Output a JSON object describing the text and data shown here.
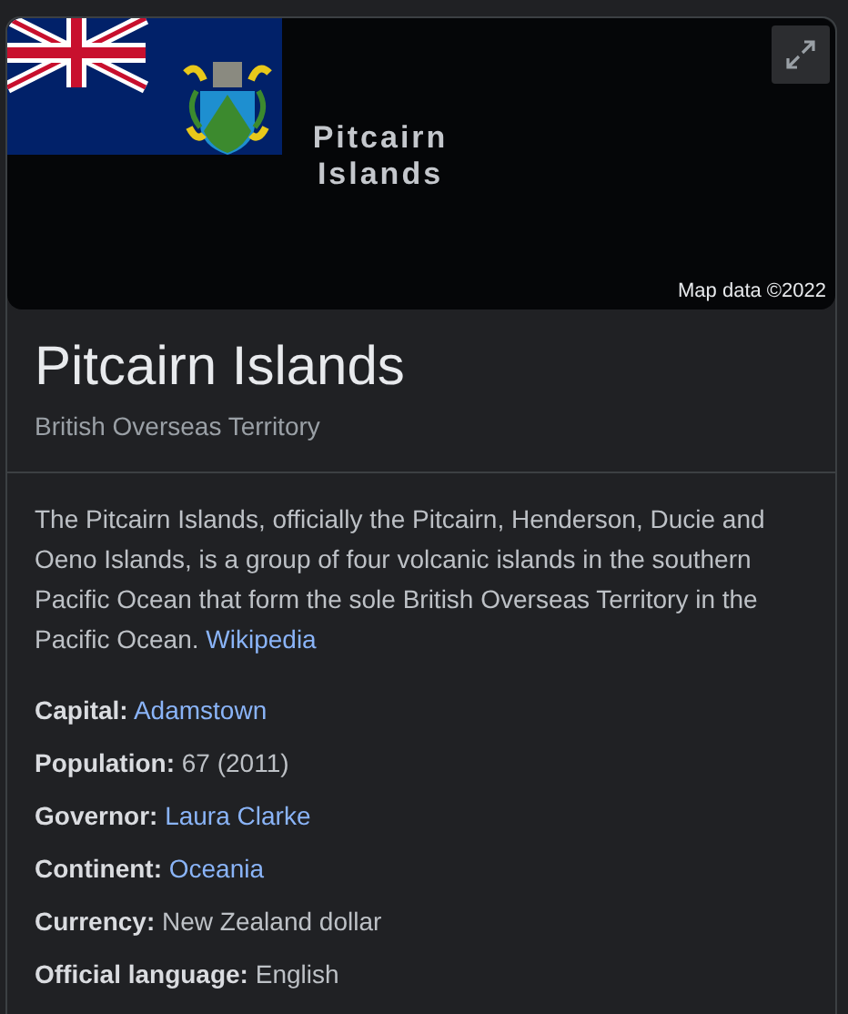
{
  "map": {
    "label": "Pitcairn Islands",
    "attribution": "Map data ©2022"
  },
  "title": "Pitcairn Islands",
  "subtitle": "British Overseas Territory",
  "description": {
    "text": "The Pitcairn Islands, officially the Pitcairn, Henderson, Ducie and Oeno Islands, is a group of four volcanic islands in the southern Pacific Ocean that form the sole British Overseas Territory in the Pacific Ocean.",
    "source": "Wikipedia"
  },
  "facts": [
    {
      "label": "Capital:",
      "value": "Adamstown",
      "kind": "link"
    },
    {
      "label": "Population:",
      "value": "67 (2011)",
      "kind": "text"
    },
    {
      "label": "Governor:",
      "value": "Laura Clarke",
      "kind": "link"
    },
    {
      "label": "Continent:",
      "value": "Oceania",
      "kind": "link"
    },
    {
      "label": "Currency:",
      "value": "New Zealand dollar",
      "kind": "text"
    },
    {
      "label": "Official language:",
      "value": "English",
      "kind": "text"
    }
  ]
}
